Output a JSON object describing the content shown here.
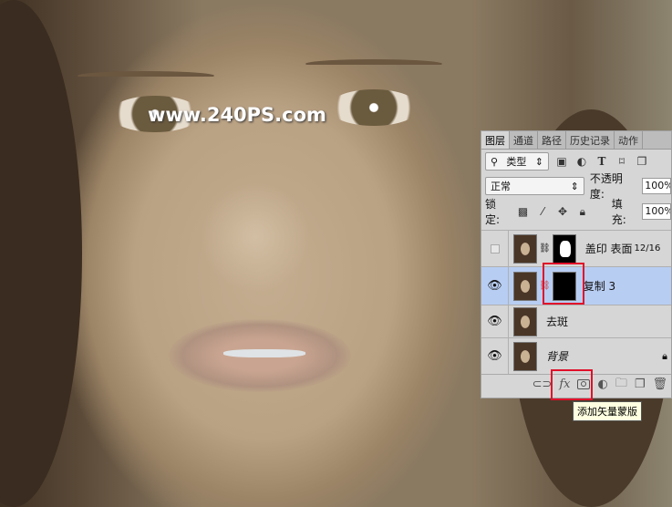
{
  "watermark": "www.240PS.com",
  "panel": {
    "tabs": [
      "图层",
      "通道",
      "路径",
      "历史记录",
      "动作"
    ],
    "active_tab": "图层",
    "filter": {
      "label": "类型",
      "icons": [
        "image-filter-icon",
        "adjustment-filter-icon",
        "type-filter-icon",
        "shape-filter-icon",
        "smart-object-filter-icon"
      ]
    },
    "blend_mode": "正常",
    "opacity_label": "不透明度:",
    "opacity": "100%",
    "lock_label": "锁定:",
    "fill_label": "填充:",
    "fill": "100%",
    "layers": [
      {
        "name": "盖印 表面",
        "extra": "12/16",
        "visible": false,
        "has_mask": true,
        "selected": false
      },
      {
        "name": "复制 3",
        "visible": true,
        "has_mask": true,
        "selected": true
      },
      {
        "name": "去斑",
        "visible": true,
        "has_mask": false,
        "selected": false
      },
      {
        "name": "背景",
        "visible": true,
        "has_mask": false,
        "selected": false,
        "locked": true
      }
    ]
  },
  "tooltip": "添加矢量蒙版",
  "colors": {
    "highlight": "#e0102a",
    "selected_layer": "#b8cdf2"
  }
}
